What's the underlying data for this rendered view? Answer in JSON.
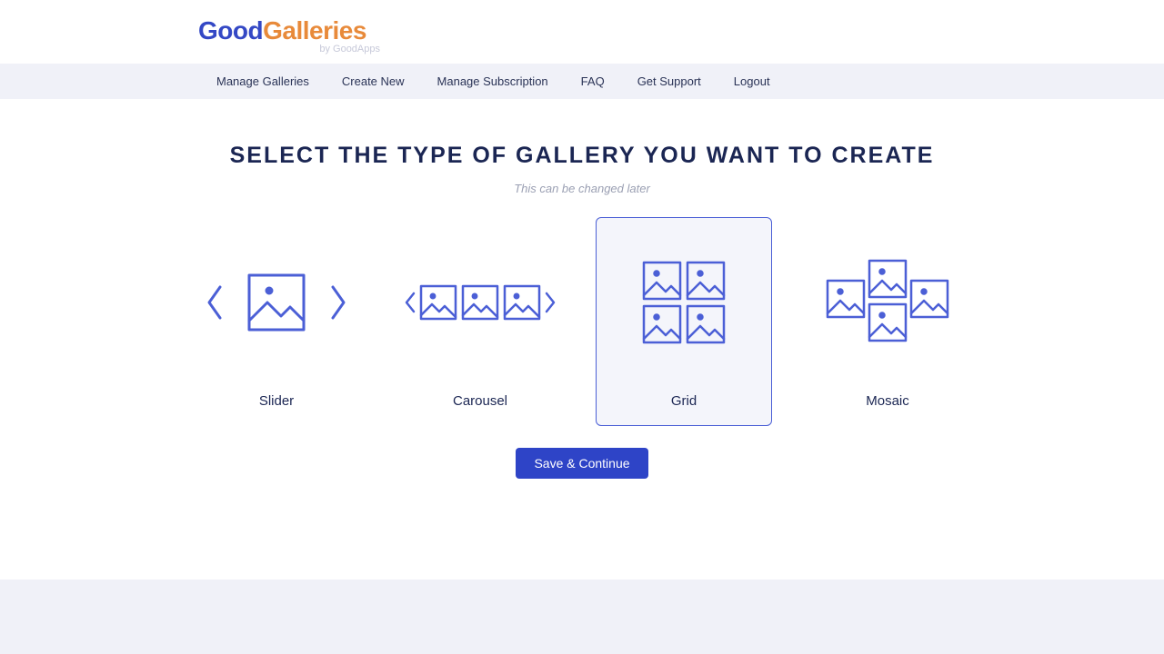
{
  "brand": {
    "part1": "Good",
    "part2": "Galleries",
    "byline": "by GoodApps"
  },
  "nav": {
    "items": [
      "Manage Galleries",
      "Create New",
      "Manage Subscription",
      "FAQ",
      "Get Support",
      "Logout"
    ]
  },
  "main": {
    "title": "Select the type of gallery you want to create",
    "subtitle": "This can be changed later",
    "save_label": "Save & Continue"
  },
  "options": [
    {
      "label": "Slider",
      "selected": false
    },
    {
      "label": "Carousel",
      "selected": false
    },
    {
      "label": "Grid",
      "selected": true
    },
    {
      "label": "Mosaic",
      "selected": false
    }
  ],
  "colors": {
    "accent": "#4b5fd6",
    "primary_btn": "#2e44c7",
    "text_dark": "#1b2653"
  }
}
